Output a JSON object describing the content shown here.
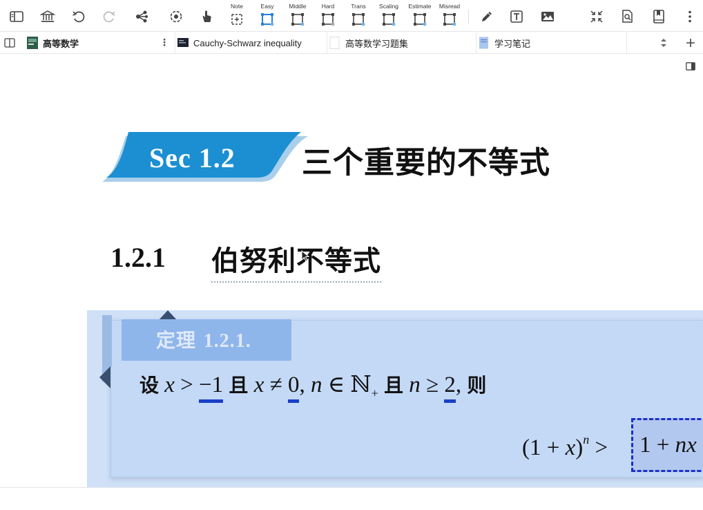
{
  "toolbar": {
    "modes": [
      {
        "label": "Note"
      },
      {
        "label": "Easy"
      },
      {
        "label": "Middle"
      },
      {
        "label": "Hard"
      },
      {
        "label": "Trans"
      },
      {
        "label": "Scaling"
      },
      {
        "label": "Estimate"
      },
      {
        "label": "Misread"
      }
    ],
    "active_mode": "Easy",
    "accent_color": "#2a7fe0"
  },
  "tabs": [
    {
      "label": "高等数学",
      "active": true,
      "menu_glyph": "⋮"
    },
    {
      "label": "Cauchy-Schwarz inequality",
      "active": false
    },
    {
      "label": "高等数学习题集",
      "active": false
    },
    {
      "label": "学习笔记",
      "active": false
    }
  ],
  "document": {
    "section_label": "Sec 1.2",
    "section_title": "三个重要的不等式",
    "subsection_number": "1.2.1",
    "subsection_title": "伯努利不等式",
    "theorem": {
      "label_cn": "定理",
      "label_num": "1.2.1.",
      "intro": "设",
      "x1": "x",
      "gt": " > ",
      "minus_one": "−1",
      "and1": "且",
      "x2": "x",
      "neq": " ≠ ",
      "zero": "0",
      "comma1": ", ",
      "n1": "n",
      "in": " ∈ ",
      "naturals": "ℕ",
      "plus_sub": "+",
      "and2": "且",
      "n2": "n",
      "geq": " ≥ ",
      "two": "2",
      "comma2": ", ",
      "then": "则",
      "lhs_open": "(1 + ",
      "lhs_x": "x",
      "lhs_close": ")",
      "lhs_exp": "n",
      "gt2": " >",
      "rhs_one": "1 + ",
      "rhs_nx": "nx"
    },
    "colors": {
      "banner": "#1b8fd2",
      "theorem_bg": "#c3d9f6",
      "underline": "#1a3fc7",
      "dashed_box": "#1a2fd0"
    }
  }
}
